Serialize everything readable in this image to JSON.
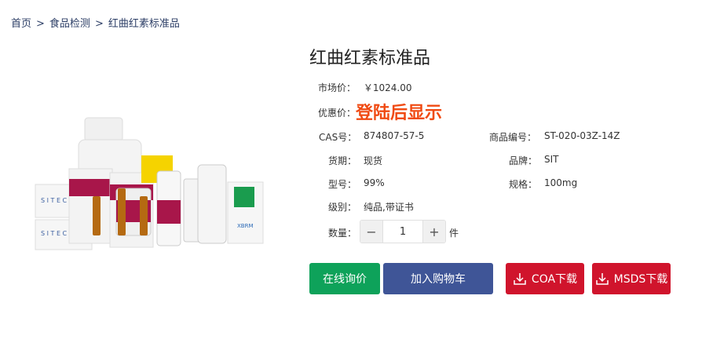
{
  "breadcrumb": {
    "home": "首页",
    "category": "食品检测",
    "current": "红曲红素标准品",
    "separator": ">"
  },
  "product": {
    "title": "红曲红素标准品",
    "market_price_label": "市场价：",
    "market_price": "￥1024.00",
    "promo_price_label": "优惠价：",
    "promo_price": "登陆后显示",
    "cas_label": "CAS号：",
    "cas": "874807-57-5",
    "code_label": "商品编号：",
    "code": "ST-020-03Z-14Z",
    "delivery_label": "货期：",
    "delivery": "现货",
    "brand_label": "品牌：",
    "brand": "SIT",
    "model_label": "型号：",
    "model": "99%",
    "spec_label": "规格：",
    "spec": "100mg",
    "grade_label": "级别：",
    "grade": "纯品,带证书",
    "qty_label": "数量：",
    "qty_value": "1",
    "qty_unit": "件"
  },
  "actions": {
    "inquiry": "在线询价",
    "cart": "加入购物车",
    "coa": "COA下载",
    "msds": "MSDS下载"
  },
  "colors": {
    "promo": "#f04a12",
    "inquiry_bg": "#0ea25a",
    "cart_bg": "#3f5597",
    "download_bg": "#d0142c"
  }
}
